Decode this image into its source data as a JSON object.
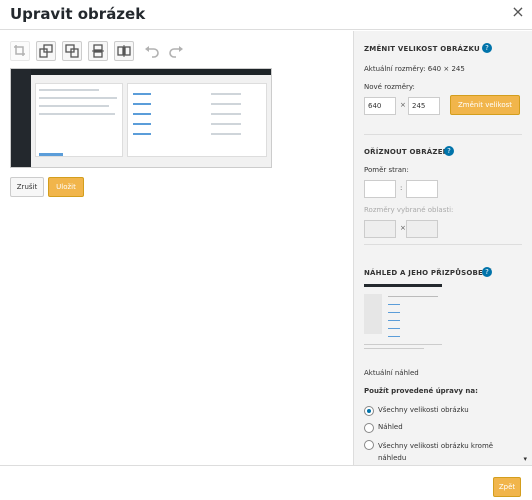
{
  "window": {
    "title": "Upravit obrázek",
    "close_symbol": "×"
  },
  "toolbar": {
    "tools": [
      {
        "name": "crop-icon",
        "enabled": false
      },
      {
        "name": "rotate-left-icon",
        "enabled": true
      },
      {
        "name": "rotate-right-icon",
        "enabled": true
      },
      {
        "name": "flip-vertical-icon",
        "enabled": true
      },
      {
        "name": "flip-horizontal-icon",
        "enabled": true
      }
    ],
    "undo_icon": "undo-icon",
    "redo_icon": "redo-icon"
  },
  "actions": {
    "cancel": "Zrušit",
    "save": "Uložit"
  },
  "scale": {
    "title": "ZMĚNIT VELIKOST OBRÁZKU",
    "current_label": "Aktuální rozměry: 640 × 245",
    "new_label": "Nové rozměry:",
    "width": "640",
    "height": "245",
    "times": "×",
    "button": "Změnit velikost"
  },
  "crop": {
    "title": "OŘÍZNOUT OBRÁZEK",
    "ratio_label": "Poměr stran:",
    "ratio_sep": ":",
    "selection_label": "Rozměry vybrané oblasti:",
    "selection_sep": "×"
  },
  "thumbnail": {
    "title": "NÁHLED A JEHO PŘIZPŮSOBENÍ",
    "current_label": "Aktuální náhled",
    "apply_label": "Použít provedené úpravy na:",
    "options": [
      {
        "label": "Všechny velikosti obrázku",
        "selected": true
      },
      {
        "label": "Náhled",
        "selected": false
      },
      {
        "label": "Všechny velikosti obrázku kromě náhledu",
        "selected": false
      }
    ]
  },
  "footer": {
    "done": "Zpět"
  },
  "colors": {
    "accent": "#f1b54b",
    "help": "#0073aa"
  }
}
